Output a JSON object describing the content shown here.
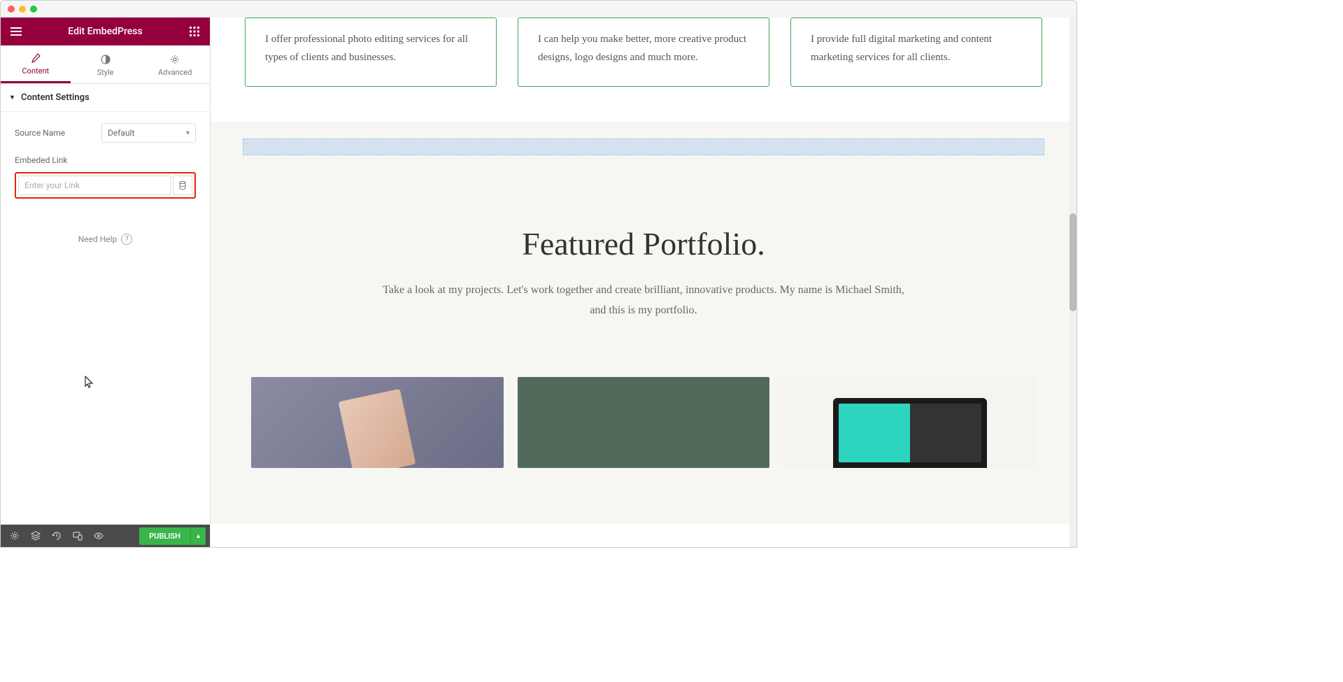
{
  "header": {
    "title": "Edit EmbedPress"
  },
  "tabs": {
    "content": "Content",
    "style": "Style",
    "advanced": "Advanced"
  },
  "section": {
    "title": "Content Settings",
    "source_label": "Source Name",
    "source_value": "Default",
    "embed_label": "Embeded Link",
    "embed_placeholder": "Enter your Link"
  },
  "help": {
    "text": "Need Help"
  },
  "footer": {
    "publish": "PUBLISH"
  },
  "canvas": {
    "cards": [
      "I offer professional photo editing services for all types of clients and businesses.",
      "I can help you make better, more creative product designs, logo designs and much more.",
      "I provide full digital marketing and content marketing services for all clients."
    ],
    "portfolio": {
      "title": "Featured Portfolio.",
      "subtitle": "Take a look at my projects. Let's work together and create brilliant, innovative products. My name is Michael Smith, and this is my portfolio."
    }
  }
}
